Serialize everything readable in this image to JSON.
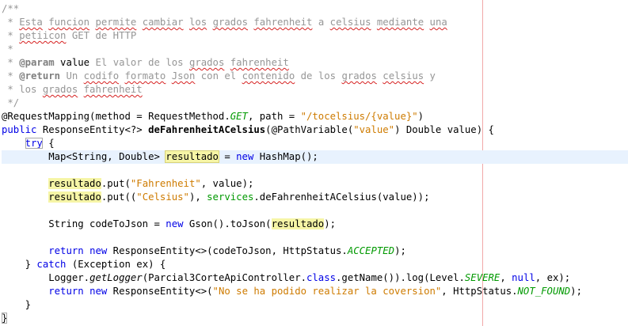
{
  "editor": {
    "language": "Java",
    "lines": [
      "/**",
      " * Esta funcion permite cambiar los grados fahrenheit a celsius mediante una",
      " * petiicon GET de HTTP",
      " *",
      " * @param value El valor de los grados fahrenheit",
      " * @return Un codifo formato Json con el contenido de los grados celsius y",
      " * los grados fahrenheit",
      " */",
      "@RequestMapping(method = RequestMethod.GET, path = \"/tocelsius/{value}\")",
      "public ResponseEntity<?> deFahrenheitACelsius(@PathVariable(\"value\") Double value) {",
      "    try {",
      "        Map<String, Double> resultado = new HashMap();",
      "",
      "        resultado.put(\"Fahrenheit\", value);",
      "        resultado.put((\"Celsius\"), services.deFahrenheitACelsius(value));",
      "",
      "        String codeToJson = new Gson().toJson(resultado);",
      "",
      "        return new ResponseEntity<>(codeToJson, HttpStatus.ACCEPTED);",
      "    } catch (Exception ex) {",
      "        Logger.getLogger(Parcial3CorteApiController.class.getName()).log(Level.SEVERE, null, ex);",
      "        return new ResponseEntity<>(\"No se ha podido realizar la coversion\", HttpStatus.NOT_FOUND);",
      "    }",
      "}"
    ],
    "current_line": 12,
    "highlighted_word": "resultado"
  },
  "tokens": {
    "l1": {
      "t1": "/**"
    },
    "l2": {
      "t1": " * ",
      "t2": "Esta",
      "t3": " ",
      "t4": "funcion",
      "t5": " ",
      "t6": "permite",
      "t7": " ",
      "t8": "cambiar",
      "t9": " ",
      "t10": "los",
      "t11": " ",
      "t12": "grados",
      "t13": " ",
      "t14": "fahrenheit",
      "t15": " a ",
      "t16": "celsius",
      "t17": " ",
      "t18": "mediante",
      "t19": " ",
      "t20": "una"
    },
    "l3": {
      "t1": " * ",
      "t2": "petiicon",
      "t3": " GET de HTTP"
    },
    "l4": {
      "t1": " *"
    },
    "l5": {
      "t1": " * ",
      "t2": "@param",
      "t3": " ",
      "t4": "value",
      "t5": " El valor de los ",
      "t6": "grados",
      "t7": " ",
      "t8": "fahrenheit"
    },
    "l6": {
      "t1": " * ",
      "t2": "@return",
      "t3": " Un ",
      "t4": "codifo",
      "t5": " ",
      "t6": "formato",
      "t7": " ",
      "t8": "Json",
      "t9": " con el ",
      "t10": "contenido",
      "t11": " de los ",
      "t12": "grados",
      "t13": " ",
      "t14": "celsius",
      "t15": " y"
    },
    "l7": {
      "t1": " * los ",
      "t2": "grados",
      "t3": " ",
      "t4": "fahrenheit"
    },
    "l8": {
      "t1": " */"
    },
    "l9": {
      "t1": "@RequestMapping(method = RequestMethod.",
      "t2": "GET",
      "t3": ", path = ",
      "t4": "\"/tocelsius/{value}\"",
      "t5": ")"
    },
    "l10": {
      "t1": "public",
      "t2": " ResponseEntity<?> ",
      "t3": "deFahrenheitACelsius",
      "t4": "(@PathVariable(",
      "t5": "\"value\"",
      "t6": ") Double value) {"
    },
    "l11": {
      "t1": "    ",
      "t2": "try",
      "t3": " {"
    },
    "l12": {
      "t1": "        Map<String, Double> ",
      "t2": "resultado",
      "t3": " = ",
      "t4": "new",
      "t5": " HashMap();"
    },
    "l14": {
      "t1": "        ",
      "t2": "resultado",
      "t3": ".put(",
      "t4": "\"Fahrenheit\"",
      "t5": ", value);"
    },
    "l15": {
      "t1": "        ",
      "t2": "resultado",
      "t3": ".put((",
      "t4": "\"Celsius\"",
      "t5": "), ",
      "t6": "services",
      "t7": ".deFahrenheitACelsius(value));"
    },
    "l17": {
      "t1": "        String codeToJson = ",
      "t2": "new",
      "t3": " Gson().toJson(",
      "t4": "resultado",
      "t5": ");"
    },
    "l19": {
      "t1": "        ",
      "t2": "return",
      "t3": " ",
      "t4": "new",
      "t5": " ResponseEntity<>(codeToJson, HttpStatus.",
      "t6": "ACCEPTED",
      "t7": ");"
    },
    "l20": {
      "t1": "    } ",
      "t2": "catch",
      "t3": " (Exception ex) {"
    },
    "l21": {
      "t1": "        Logger.",
      "t2": "getLogger",
      "t3": "(Parcial3CorteApiController.",
      "t4": "class",
      "t5": ".getName()).log(Level.",
      "t6": "SEVERE",
      "t7": ", ",
      "t8": "null",
      "t9": ", ex);"
    },
    "l22": {
      "t1": "        ",
      "t2": "return",
      "t3": " ",
      "t4": "new",
      "t5": " ResponseEntity<>(",
      "t6": "\"No se ha podido realizar la coversion\"",
      "t7": ", HttpStatus.",
      "t8": "NOT_FOUND",
      "t9": ");"
    },
    "l23": {
      "t1": "    }"
    },
    "l24": {
      "t1": "}"
    }
  },
  "colors": {
    "keyword": "#0000e6",
    "string": "#ce7b00",
    "constant": "#009900",
    "comment": "#969696",
    "occurrence_highlight": "#f6f5a6",
    "current_line": "#e8f2fe",
    "spell_error": "#d62020",
    "right_margin": "#f2a8a8"
  }
}
